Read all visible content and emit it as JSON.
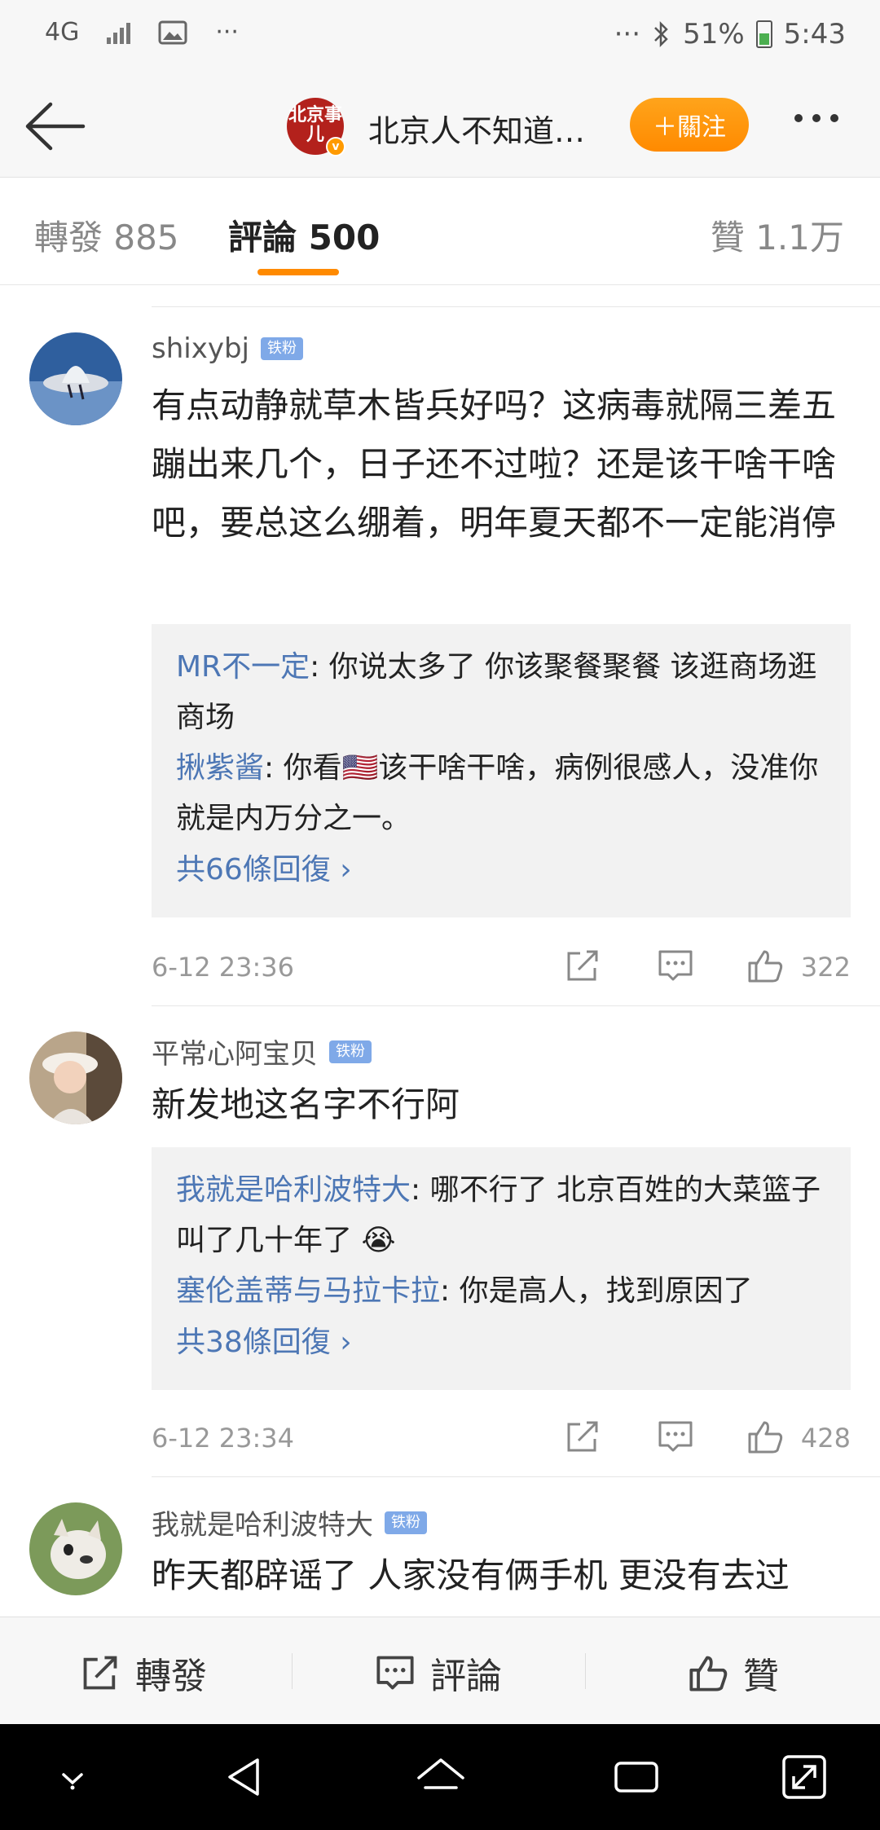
{
  "status_bar": {
    "network": "4G",
    "dots": "···",
    "right_dots": "···",
    "battery": "51%",
    "time": "5:43"
  },
  "header": {
    "logo_text": "北京事儿",
    "title": "北京人不知道…",
    "follow_label": "＋關注"
  },
  "tabs": [
    {
      "label": "轉發 885"
    },
    {
      "label": "評論 500"
    },
    {
      "label": "贊 1.1万"
    }
  ],
  "comments": [
    {
      "user": "shixybj",
      "badge": "铁粉",
      "text": "有点动静就草木皆兵好吗？这病毒就隔三差五蹦出来几个，日子还不过啦？还是该干啥干啥吧，要总这么绷着，明年夏天都不一定能消停",
      "replies": [
        {
          "user": "MR不一定",
          "text": ": 你说太多了 你该聚餐聚餐 该逛商场逛商场"
        },
        {
          "user": "揪紫酱",
          "text": ": 你看🇺🇸该干啥干啥，病例很感人，没准你就是内万分之一。"
        }
      ],
      "more_replies": "共66條回復 ›",
      "time": "6-12 23:36",
      "likes": "322"
    },
    {
      "user": "平常心阿宝贝",
      "badge": "铁粉",
      "text": "新发地这名字不行阿",
      "replies": [
        {
          "user": "我就是哈利波特大",
          "text": ": 哪不行了 北京百姓的大菜篮子 叫了几十年了 😭"
        },
        {
          "user": "塞伦盖蒂与马拉卡拉",
          "text": ": 你是高人，找到原因了"
        }
      ],
      "more_replies": "共38條回復 ›",
      "time": "6-12 23:34",
      "likes": "428"
    },
    {
      "user": "我就是哈利波特大",
      "badge": "铁粉",
      "text": "昨天都辟谣了 人家没有俩手机 更没有去过"
    }
  ],
  "bottom_bar": {
    "repost_label": "轉發",
    "comment_label": "評論",
    "like_label": "贊"
  },
  "colors": {
    "accent_orange": "#ff8a00",
    "link_blue": "#4d77b5",
    "fan_badge": "#7fa9e8"
  }
}
